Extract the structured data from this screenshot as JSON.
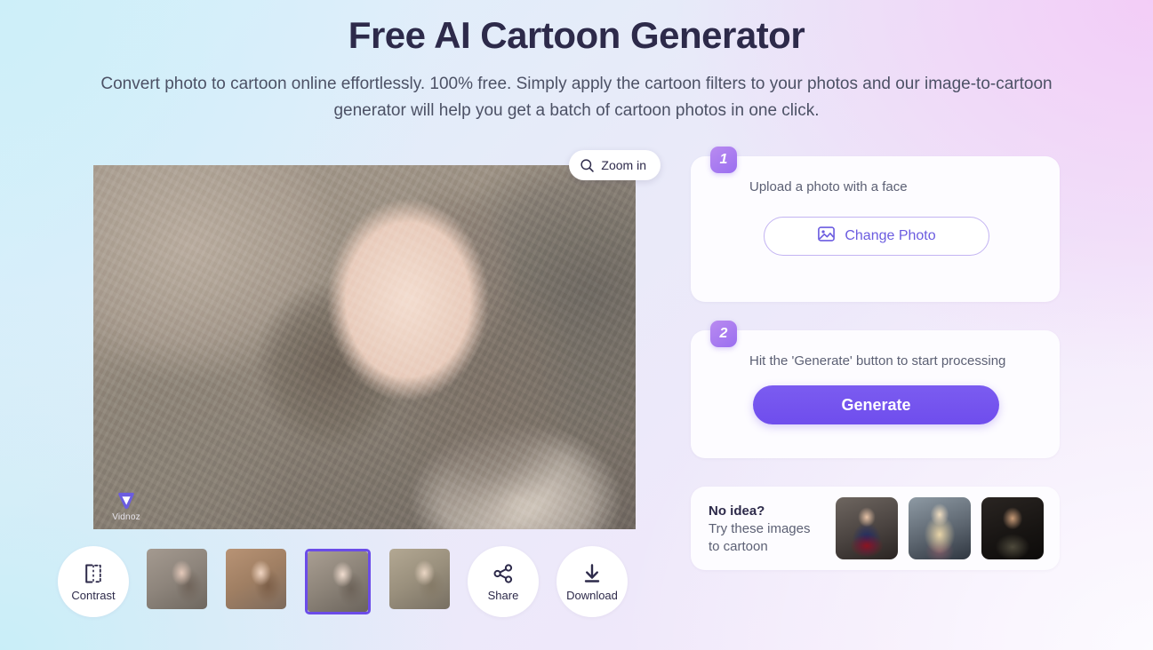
{
  "header": {
    "title": "Free AI Cartoon Generator",
    "subtitle": "Convert photo to cartoon online effortlessly. 100% free. Simply apply the cartoon filters to your photos and our image-to-cartoon generator will help you get a batch of cartoon photos in one click."
  },
  "preview": {
    "zoom_button_label": "Zoom in",
    "zoom_icon": "magnifier-icon",
    "watermark_text": "Vidnoz",
    "watermark_icon": "vidnoz-logo-icon"
  },
  "toolbar": {
    "contrast": {
      "label": "Contrast",
      "icon": "contrast-icon"
    },
    "share": {
      "label": "Share",
      "icon": "share-icon"
    },
    "download": {
      "label": "Download",
      "icon": "download-arrow-icon"
    },
    "thumbnails": [
      {
        "name": "style-variant-1",
        "selected": false
      },
      {
        "name": "style-variant-2",
        "selected": false
      },
      {
        "name": "style-variant-3",
        "selected": true
      },
      {
        "name": "style-variant-4",
        "selected": false
      }
    ]
  },
  "steps": [
    {
      "number": "1",
      "text": "Upload a photo with a face",
      "button_label": "Change Photo",
      "button_icon": "image-photo-icon"
    },
    {
      "number": "2",
      "text": "Hit the 'Generate' button to start processing",
      "button_label": "Generate"
    }
  ],
  "ideas": {
    "title": "No idea?",
    "subtitle": "Try these images to cartoon",
    "samples": [
      {
        "name": "sample-superhero"
      },
      {
        "name": "sample-blonde-woman"
      },
      {
        "name": "sample-bald-man"
      }
    ]
  },
  "colors": {
    "accent_purple": "#6f4ded",
    "selected_border": "#6b4ce8",
    "title_ink": "#2d2a4a",
    "body_ink": "#5c6074",
    "badge_gradient_from": "#b98bf0",
    "badge_gradient_to": "#9a6ef0"
  }
}
